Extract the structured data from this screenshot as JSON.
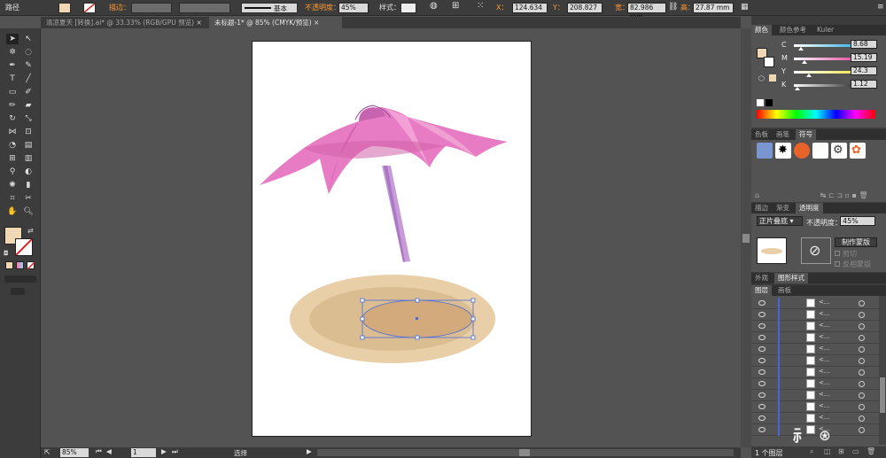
{
  "control_bar": {
    "object_label": "路径",
    "stroke_label": "描边：",
    "stroke_style_label": "基本",
    "opacity_label": "不透明度：",
    "opacity_value": "45%",
    "style_label": "样式：",
    "x_label": "X：",
    "x_value": "124.634",
    "y_label": "Y：",
    "y_value": "208.827",
    "w_label": "宽：",
    "w_value": "82.986 mm",
    "h_label": "高：",
    "h_value": "27.87 mm",
    "fill_color": "#f0d8b4"
  },
  "doc_tabs": [
    {
      "label": "清凉夏天 [转换].ai* @ 33.33% (RGB/GPU 预览)",
      "active": false
    },
    {
      "label": "未标题-1* @ 85% (CMYK/预览)",
      "active": true
    }
  ],
  "status_bar": {
    "zoom": "85%",
    "page": "1",
    "tool": "选择"
  },
  "color_panel": {
    "tabs": [
      "颜色",
      "颜色参考",
      "Kuler"
    ],
    "channels": [
      {
        "label": "C",
        "value": "8.68",
        "pos": 0.09
      },
      {
        "label": "M",
        "value": "15.19",
        "pos": 0.15
      },
      {
        "label": "Y",
        "value": "24.3",
        "pos": 0.24
      },
      {
        "label": "K",
        "value": "1.12",
        "pos": 0.01
      }
    ]
  },
  "symbols_panel": {
    "tabs": [
      "色板",
      "画笔",
      "符号"
    ]
  },
  "transparency_panel": {
    "tabs": [
      "描边",
      "渐变",
      "透明度"
    ],
    "blend_mode": "正片叠底",
    "opacity_label": "不透明度：",
    "opacity_value": "45%",
    "make_mask_label": "制作蒙版",
    "clip_label": "剪切",
    "invert_label": "反相蒙版"
  },
  "appearance_tabs": [
    "外观",
    "图形样式"
  ],
  "layers_panel": {
    "tabs": [
      "图层",
      "画板"
    ],
    "rows": [
      "<...",
      "<...",
      "<...",
      "<...",
      "<...",
      "<...",
      "<...",
      "<...",
      "<...",
      "<...",
      "<...",
      "<..."
    ],
    "footer": "1 个图层"
  },
  "colors": {
    "umbrella_pink": "#e87cc4",
    "umbrella_pole": "#c89ad8",
    "sand_outer": "#e8cfa8",
    "sand_mid": "#dbbd92",
    "sand_inner": "#d2aa7c"
  }
}
